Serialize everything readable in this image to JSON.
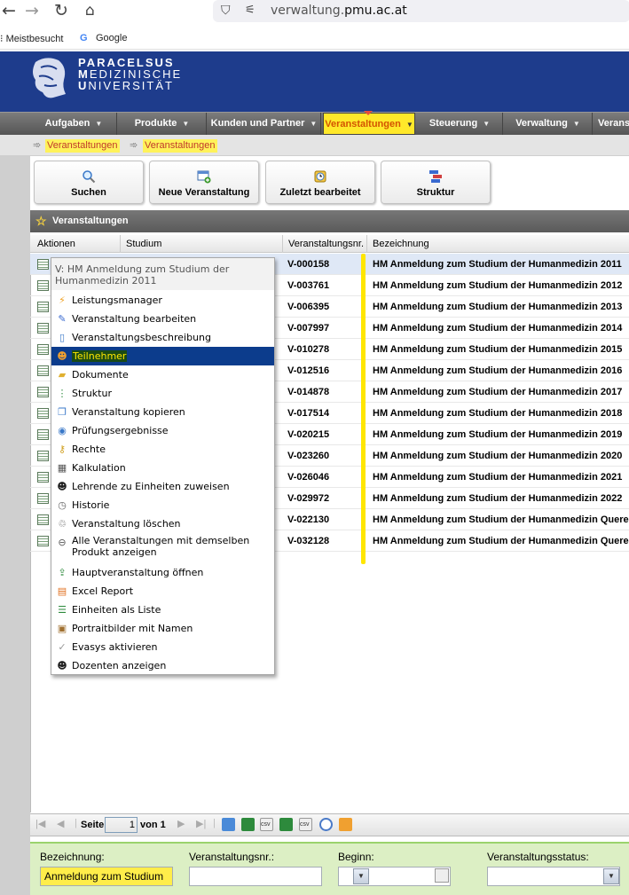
{
  "browser": {
    "url_prefix": "verwaltung.",
    "url_domain": "pmu.ac.at",
    "bookmarks": [
      "Meistbesucht",
      "Google"
    ]
  },
  "logo": {
    "line1": "PARACELSUS",
    "line2_initial": "M",
    "line2_rest": "EDIZINISCHE",
    "line3_initial": "U",
    "line3_rest": "NIVERSITÄT"
  },
  "nav": [
    "Aufgaben",
    "Produkte",
    "Kunden und Partner",
    "Veranstaltungen",
    "Steuerung",
    "Verwaltung",
    "Verans"
  ],
  "breadcrumbs": [
    "Veranstaltungen",
    "Veranstaltungen"
  ],
  "toolbar": [
    "Suchen",
    "Neue Veranstaltung",
    "Zuletzt bearbeitet",
    "Struktur"
  ],
  "panel": {
    "title": "Veranstaltungen",
    "columns": [
      "Aktionen",
      "Studium",
      "Veranstaltungsnr.",
      "Bezeichnung"
    ]
  },
  "rows": [
    {
      "nr": "V-000158",
      "bez": "HM Anmeldung zum Studium der Humanmedizin 2011"
    },
    {
      "nr": "V-003761",
      "bez": "HM Anmeldung zum Studium der Humanmedizin 2012"
    },
    {
      "nr": "V-006395",
      "bez": "HM Anmeldung zum Studium der Humanmedizin 2013"
    },
    {
      "nr": "V-007997",
      "bez": "HM Anmeldung zum Studium der Humanmedizin 2014"
    },
    {
      "nr": "V-010278",
      "bez": "HM Anmeldung zum Studium der Humanmedizin 2015"
    },
    {
      "nr": "V-012516",
      "bez": "HM Anmeldung zum Studium der Humanmedizin 2016"
    },
    {
      "nr": "V-014878",
      "bez": "HM Anmeldung zum Studium der Humanmedizin 2017"
    },
    {
      "nr": "V-017514",
      "bez": "HM Anmeldung zum Studium der Humanmedizin 2018"
    },
    {
      "nr": "V-020215",
      "bez": "HM Anmeldung zum Studium der Humanmedizin 2019"
    },
    {
      "nr": "V-023260",
      "bez": "HM Anmeldung zum Studium der Humanmedizin 2020"
    },
    {
      "nr": "V-026046",
      "bez": "HM Anmeldung zum Studium der Humanmedizin 2021"
    },
    {
      "nr": "V-029972",
      "bez": "HM Anmeldung zum Studium der Humanmedizin 2022"
    },
    {
      "nr": "V-022130",
      "bez": "HM Anmeldung zum Studium der Humanmedizin Quereinst"
    },
    {
      "nr": "V-032128",
      "bez": "HM Anmeldung zum Studium der Humanmedizin Quereinst"
    }
  ],
  "context_menu": {
    "title_line1": "V: HM Anmeldung zum Studium der",
    "title_line2": "Humanmedizin 2011",
    "items": [
      {
        "label": "Leistungsmanager",
        "icon": "lightning-icon"
      },
      {
        "label": "Veranstaltung bearbeiten",
        "icon": "edit-icon"
      },
      {
        "label": "Veranstaltungsbeschreibung",
        "icon": "document-icon"
      },
      {
        "label": "Teilnehmer",
        "icon": "user-icon"
      },
      {
        "label": "Dokumente",
        "icon": "folder-icon"
      },
      {
        "label": "Struktur",
        "icon": "tree-icon"
      },
      {
        "label": "Veranstaltung kopieren",
        "icon": "copy-icon"
      },
      {
        "label": "Prüfungsergebnisse",
        "icon": "play-circle-icon"
      },
      {
        "label": "Rechte",
        "icon": "key-icon"
      },
      {
        "label": "Kalkulation",
        "icon": "calculator-icon"
      },
      {
        "label": "Lehrende zu Einheiten zuweisen",
        "icon": "teacher-icon"
      },
      {
        "label": "Historie",
        "icon": "clock-icon"
      },
      {
        "label": "Veranstaltung löschen",
        "icon": "trash-icon"
      },
      {
        "label_line1": "Alle Veranstaltungen mit demselben",
        "label_line2": "Produkt anzeigen",
        "icon": "link-icon"
      },
      {
        "label": "Hauptveranstaltung öffnen",
        "icon": "open-icon"
      },
      {
        "label": "Excel Report",
        "icon": "excel-icon"
      },
      {
        "label": "Einheiten als Liste",
        "icon": "list-icon"
      },
      {
        "label": "Portraitbilder mit Namen",
        "icon": "portrait-icon"
      },
      {
        "label": "Evasys aktivieren",
        "icon": "check-icon"
      },
      {
        "label": "Dozenten anzeigen",
        "icon": "lecturer-icon"
      }
    ]
  },
  "pager": {
    "page_label": "Seite",
    "page_value": "1",
    "of_label": "von 1"
  },
  "filter": {
    "bezeichnung_label": "Bezeichnung:",
    "bezeichnung_value": "Anmeldung zum Studium",
    "nr_label": "Veranstaltungsnr.:",
    "beginn_label": "Beginn:",
    "status_label": "Veranstaltungsstatus:"
  },
  "colors": {
    "banner": "#1e3c8c",
    "highlight": "#ffe600",
    "menu_highlight": "#0c3c8c"
  }
}
